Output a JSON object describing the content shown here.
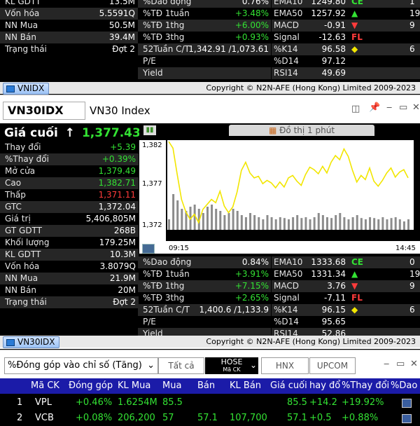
{
  "top_panel": {
    "left": [
      {
        "label": "KL GDTT",
        "value": "13.5M",
        "cls": "w"
      },
      {
        "label": "Vốn hóa",
        "value": "5.5591Q",
        "cls": "w"
      },
      {
        "label": "NN Mua",
        "value": "50.5M",
        "cls": "w"
      },
      {
        "label": "NN Bán",
        "value": "39.4M",
        "cls": "w"
      },
      {
        "label": "Trạng thái",
        "value": "Đợt 2",
        "cls": "w"
      }
    ],
    "mid": [
      {
        "label": "%Dao động",
        "value": "0.76%",
        "cls": "w"
      },
      {
        "label": "%TĐ 1tuần",
        "value": "+3.48%",
        "cls": "g"
      },
      {
        "label": "%TĐ 1thg",
        "value": "+6.00%",
        "cls": "g"
      },
      {
        "label": "%TĐ 3thg",
        "value": "+0.93%",
        "cls": "g"
      },
      {
        "label": "52Tuần C/T",
        "value": "1,342.91 /1,073.61",
        "cls": "w"
      },
      {
        "label": "P/E",
        "value": "",
        "cls": "w"
      },
      {
        "label": "Yield",
        "value": "",
        "cls": "w"
      }
    ],
    "right": [
      {
        "label": "EMA10",
        "value": "1249.80",
        "mark": "CE",
        "markcls": "g",
        "extra": "1"
      },
      {
        "label": "EMA50",
        "value": "1257.92",
        "mark": "▲",
        "markcls": "g",
        "extra": "19"
      },
      {
        "label": "MACD",
        "value": "-0.91",
        "mark": "▼",
        "markcls": "r",
        "extra": "9"
      },
      {
        "label": "Signal",
        "value": "-12.63",
        "mark": "FL",
        "markcls": "r",
        "extra": ""
      },
      {
        "label": "%K14",
        "value": "96.58",
        "mark": "◆",
        "markcls": "y",
        "extra": "6"
      },
      {
        "label": "%D14",
        "value": "97.12",
        "mark": "",
        "markcls": "w",
        "extra": ""
      },
      {
        "label": "RSI14",
        "value": "49.69",
        "mark": "",
        "markcls": "w",
        "extra": ""
      }
    ],
    "tab_label": "VNIDX",
    "copyright": "Copyright © N2N-AFE (Hong Kong) Limited 2009-2023"
  },
  "window": {
    "symbol": "VN30IDX",
    "name": "VN30 Index",
    "close_label": "Giá cuối",
    "arrow": "↑",
    "close_value": "1,377.43",
    "chart_tab": "Đồ thị 1 phút"
  },
  "stats": [
    {
      "label": "Thay đổi",
      "value": "+5.39",
      "cls": "g"
    },
    {
      "label": "%Thay đổi",
      "value": "+0.39%",
      "cls": "g"
    },
    {
      "label": "Mở cửa",
      "value": "1,379.49",
      "cls": "g"
    },
    {
      "label": "Cao",
      "value": "1,382.71",
      "cls": "g"
    },
    {
      "label": "Thấp",
      "value": "1,371.11",
      "cls": "r"
    },
    {
      "label": "GTC",
      "value": "1,372.04",
      "cls": "w"
    },
    {
      "label": "Giá trị",
      "value": "5,406,805M",
      "cls": "w"
    },
    {
      "label": "GT GDTT",
      "value": "268B",
      "cls": "w"
    },
    {
      "label": "Khối lượng",
      "value": "179.25M",
      "cls": "w"
    },
    {
      "label": "KL GDTT",
      "value": "10.3M",
      "cls": "w"
    },
    {
      "label": "Vốn hóa",
      "value": "3.8079Q",
      "cls": "w"
    },
    {
      "label": "NN Mua",
      "value": "21.9M",
      "cls": "w"
    },
    {
      "label": "NN Bán",
      "value": "20M",
      "cls": "w"
    },
    {
      "label": "Trạng thái",
      "value": "Đợt 2",
      "cls": "w"
    }
  ],
  "chart_data": {
    "type": "line",
    "title": "Đồ thị 1 phút",
    "ylim": [
      1372,
      1382
    ],
    "y_ticks": [
      "1,382",
      "1,377",
      "1,372"
    ],
    "x_ticks": [
      "09:15",
      "14:45"
    ],
    "x_start_label": "09:15",
    "x_end_label": "14:45",
    "values": [
      1382.0,
      1381.2,
      1378.0,
      1375.0,
      1373.5,
      1372.6,
      1373.2,
      1372.2,
      1373.8,
      1374.4,
      1375.0,
      1374.6,
      1376.0,
      1374.2,
      1373.4,
      1374.1,
      1375.9,
      1378.5,
      1379.5,
      1378.2,
      1377.6,
      1377.8,
      1376.9,
      1377.3,
      1377.0,
      1376.4,
      1377.1,
      1376.5,
      1377.6,
      1377.9,
      1377.2,
      1376.7,
      1378.0,
      1378.9,
      1378.6,
      1378.1,
      1379.0,
      1378.2,
      1379.5,
      1380.3,
      1379.8,
      1381.1,
      1380.2,
      1378.5,
      1377.1,
      1377.9,
      1377.4,
      1378.8,
      1377.2,
      1376.6,
      1377.3,
      1378.2,
      1378.8,
      1377.7,
      1378.3,
      1378.6,
      1377.6
    ],
    "volume": [
      0.25,
      0.85,
      0.7,
      0.5,
      0.45,
      0.55,
      0.6,
      0.5,
      0.4,
      0.55,
      0.6,
      0.5,
      0.45,
      0.35,
      0.4,
      0.5,
      0.45,
      0.35,
      0.3,
      0.4,
      0.35,
      0.3,
      0.25,
      0.35,
      0.3,
      0.25,
      0.3,
      0.28,
      0.25,
      0.3,
      0.35,
      0.28,
      0.3,
      0.25,
      0.3,
      0.4,
      0.35,
      0.3,
      0.28,
      0.35,
      0.4,
      0.3,
      0.25,
      0.3,
      0.35,
      0.28,
      0.25,
      0.3,
      0.28,
      0.25,
      0.3,
      0.25,
      0.28,
      0.3,
      0.25,
      0.2,
      0.25
    ]
  },
  "mid_stats": [
    {
      "label": "%Dao động",
      "value": "0.84%",
      "cls": "w"
    },
    {
      "label": "%TĐ 1tuần",
      "value": "+3.91%",
      "cls": "g"
    },
    {
      "label": "%TĐ 1thg",
      "value": "+7.15%",
      "cls": "g"
    },
    {
      "label": "%TĐ 3thg",
      "value": "+2.65%",
      "cls": "g"
    },
    {
      "label": "52Tuần C/T",
      "value": "1,400.6 /1,133.9",
      "cls": "w"
    },
    {
      "label": "P/E",
      "value": "",
      "cls": "w"
    },
    {
      "label": "Yield",
      "value": "",
      "cls": "w"
    }
  ],
  "tech_stats": [
    {
      "label": "EMA10",
      "value": "1333.68",
      "mark": "CE",
      "markcls": "g",
      "extra": "0"
    },
    {
      "label": "EMA50",
      "value": "1331.34",
      "mark": "▲",
      "markcls": "g",
      "extra": "19"
    },
    {
      "label": "MACD",
      "value": "3.76",
      "mark": "▼",
      "markcls": "r",
      "extra": "9"
    },
    {
      "label": "Signal",
      "value": "-7.11",
      "mark": "FL",
      "markcls": "r",
      "extra": ""
    },
    {
      "label": "%K14",
      "value": "96.15",
      "mark": "◆",
      "markcls": "y",
      "extra": "6"
    },
    {
      "label": "%D14",
      "value": "95.65",
      "mark": "",
      "markcls": "w",
      "extra": ""
    },
    {
      "label": "RSI14",
      "value": "52.86",
      "mark": "",
      "markcls": "w",
      "extra": ""
    }
  ],
  "bottom_tab": "VN30IDX",
  "copyright": "Copyright © N2N-AFE (Hong Kong) Limited 2009-2023",
  "toolbar": {
    "select_value": "%Đóng góp vào chỉ số (Tăng)",
    "all_label": "Tất cả",
    "hose_label": "HOSE",
    "hose_sub": "Mã CK",
    "hnx_label": "HNX",
    "upcom_label": "UPCOM"
  },
  "table": {
    "headers": [
      "Mã CK",
      "Đóng góp",
      "KL Mua",
      "Mua",
      "Bán",
      "KL Bán",
      "Giá cuối",
      "hay đổ",
      "%Thay đổi",
      "%Dao"
    ],
    "rows": [
      {
        "num": "1",
        "symbol": "VPL",
        "cells": [
          "+0.46%",
          "1.6254M",
          "85.5",
          "",
          "",
          "85.5",
          "+14.2",
          "+19.92%"
        ]
      },
      {
        "num": "2",
        "symbol": "VCB",
        "cells": [
          "+0.08%",
          "206,200",
          "57",
          "57.1",
          "107,700",
          "57.1",
          "+0.5",
          "+0.88%"
        ]
      }
    ]
  }
}
